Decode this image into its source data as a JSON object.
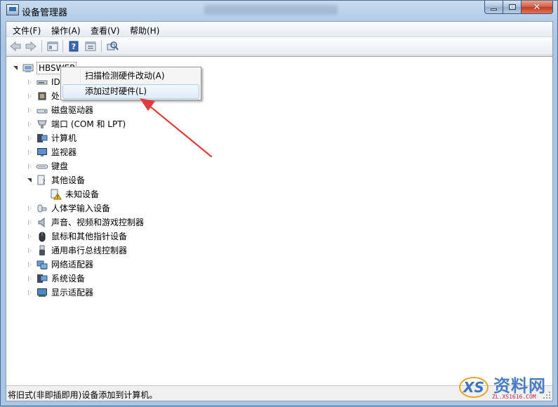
{
  "window": {
    "title": "设备管理器"
  },
  "menubar": {
    "items": [
      "文件(F)",
      "操作(A)",
      "查看(V)",
      "帮助(H)"
    ]
  },
  "toolbar": {
    "icons": [
      "back-arrow-icon",
      "forward-arrow-icon",
      "properties-icon",
      "help-icon",
      "update-driver-icon",
      "scan-hardware-icon"
    ]
  },
  "tree": {
    "root": "HBSWEP",
    "nodes": [
      {
        "label": "IDE ATA/ATAPI 控制器",
        "visible": "ID",
        "icon": "ide-controller-icon",
        "expanded": false
      },
      {
        "label": "处理器",
        "visible": "处",
        "icon": "processor-icon",
        "expanded": false
      },
      {
        "label": "磁盘驱动器",
        "icon": "disk-drive-icon",
        "expanded": false
      },
      {
        "label": "端口 (COM 和 LPT)",
        "icon": "port-icon",
        "expanded": false
      },
      {
        "label": "计算机",
        "icon": "computer-icon",
        "expanded": false
      },
      {
        "label": "监视器",
        "icon": "monitor-icon",
        "expanded": false
      },
      {
        "label": "键盘",
        "icon": "keyboard-icon",
        "expanded": false
      },
      {
        "label": "其他设备",
        "icon": "other-devices-icon",
        "expanded": true
      },
      {
        "label": "未知设备",
        "icon": "unknown-device-warning-icon",
        "child": true
      },
      {
        "label": "人体学输入设备",
        "icon": "hid-icon",
        "expanded": false
      },
      {
        "label": "声音、视频和游戏控制器",
        "icon": "speaker-icon",
        "expanded": false
      },
      {
        "label": "鼠标和其他指针设备",
        "icon": "mouse-icon",
        "expanded": false
      },
      {
        "label": "通用串行总线控制器",
        "icon": "usb-icon",
        "expanded": false
      },
      {
        "label": "网络适配器",
        "icon": "network-adapter-icon",
        "expanded": false
      },
      {
        "label": "系统设备",
        "icon": "system-device-icon",
        "expanded": false
      },
      {
        "label": "显示适配器",
        "icon": "display-adapter-icon",
        "expanded": false
      }
    ]
  },
  "context_menu": {
    "items": [
      {
        "label": "扫描检测硬件改动(A)",
        "highlighted": false
      },
      {
        "label": "添加过时硬件(L)",
        "highlighted": true
      }
    ]
  },
  "statusbar": {
    "text": "将旧式(非即插即用)设备添加到计算机。"
  },
  "watermark": {
    "title": "资料网",
    "subtitle": "ZL.XS1616.COM"
  },
  "colors": {
    "annotation_arrow": "#e23b3b",
    "titlebar": "#b3cde8",
    "close_button": "#c23a23"
  }
}
